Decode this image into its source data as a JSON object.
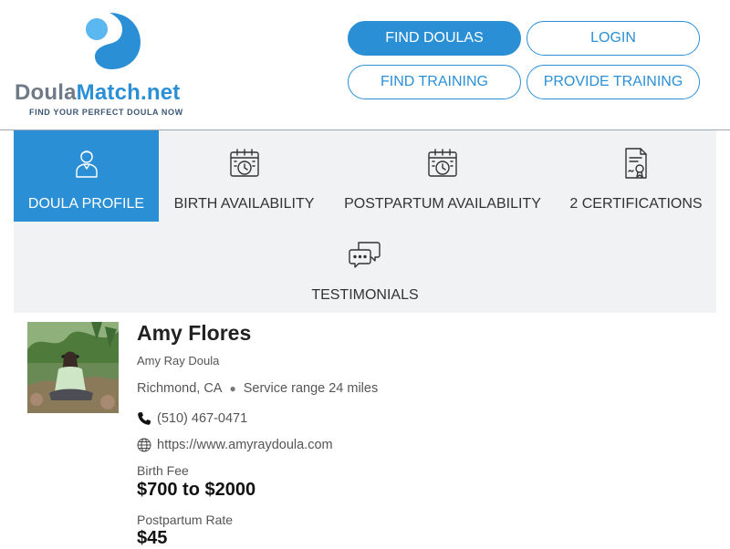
{
  "brand": {
    "name_part1": "Doula",
    "name_part2": "Match.net",
    "tagline": "FIND YOUR PERFECT DOULA NOW",
    "colors": {
      "accent": "#2b8fd6",
      "grey_text": "#6f7a86",
      "tab_bg": "#f1f2f3"
    }
  },
  "nav": {
    "find_doulas": "FIND DOULAS",
    "login": "LOGIN",
    "find_training": "FIND TRAINING",
    "provide_training": "PROVIDE TRAINING"
  },
  "tabs": [
    {
      "label": "DOULA PROFILE",
      "icon": "person-icon",
      "active": true
    },
    {
      "label": "BIRTH AVAILABILITY",
      "icon": "calendar-clock-icon",
      "active": false
    },
    {
      "label": "POSTPARTUM AVAILABILITY",
      "icon": "calendar-clock-icon",
      "active": false
    },
    {
      "label": "2 CERTIFICATIONS",
      "icon": "certificate-icon",
      "active": false
    },
    {
      "label": "TESTIMONIALS",
      "icon": "chat-bubbles-icon",
      "active": false
    }
  ],
  "profile": {
    "name": "Amy Flores",
    "business": "Amy Ray Doula",
    "location": "Richmond, CA",
    "service_range": "Service range 24 miles",
    "phone": "(510) 467-0471",
    "website": "https://www.amyraydoula.com",
    "birth_fee_label": "Birth Fee",
    "birth_fee": "$700 to $2000",
    "postpartum_label": "Postpartum Rate",
    "postpartum_rate": "$45"
  }
}
